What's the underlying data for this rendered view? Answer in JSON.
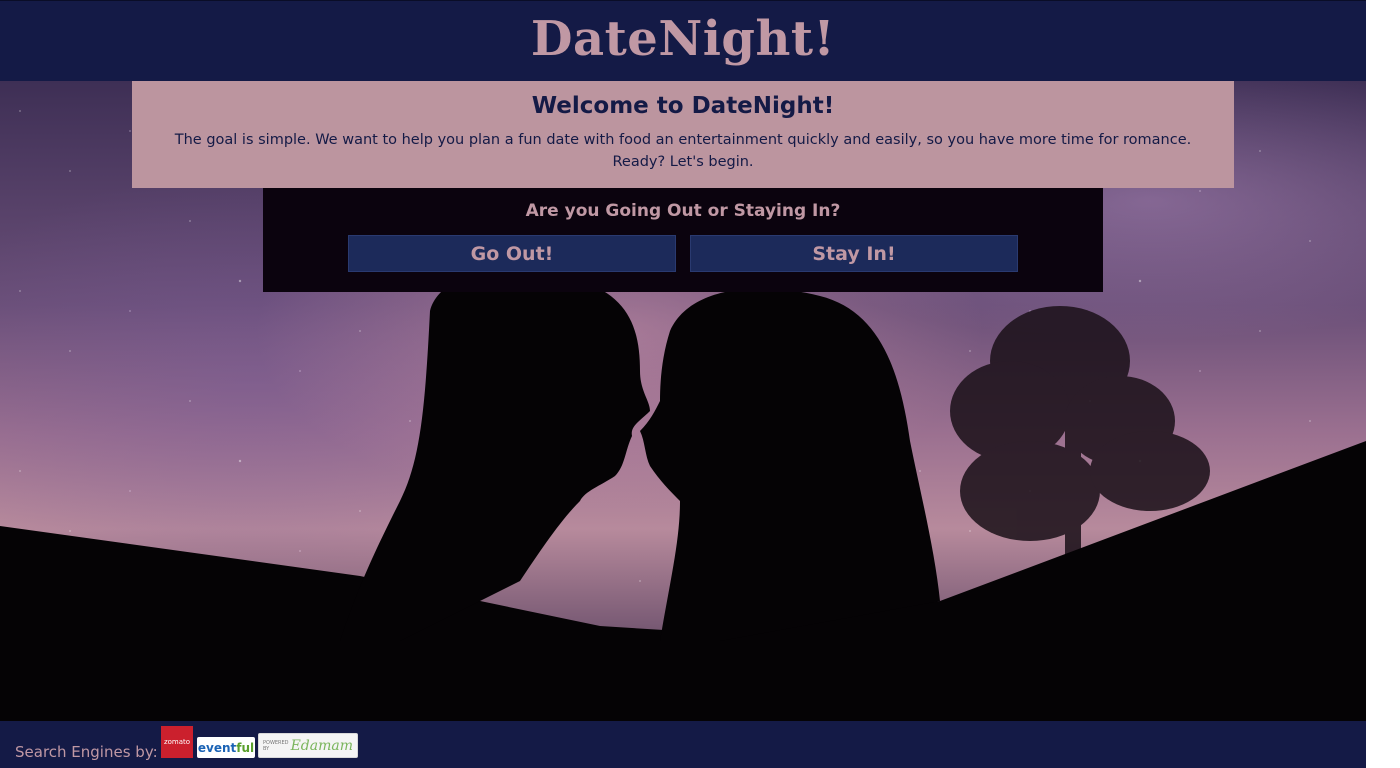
{
  "header": {
    "title": "DateNight!"
  },
  "welcome": {
    "heading": "Welcome to DateNight!",
    "line1": "The goal is simple. We want to help you plan a fun date with food an entertainment quickly and easily, so you have more time for romance.",
    "line2": "Ready? Let's begin."
  },
  "choice": {
    "question": "Are you Going Out or Staying In?",
    "go_out_label": "Go Out!",
    "stay_in_label": "Stay In!"
  },
  "footer": {
    "label": "Search Engines by:",
    "logos": [
      {
        "name": "zomato",
        "text": "zomato"
      },
      {
        "name": "eventful",
        "text_a": "event",
        "text_b": "ful"
      },
      {
        "name": "edamam",
        "prefix": "POWERED BY",
        "text": "Edamam"
      }
    ]
  },
  "colors": {
    "header_bg": "#141a46",
    "title_pink": "#c098a4",
    "welcome_bg": "#bc959f",
    "choice_bg": "#0b030e",
    "button_bg": "#1c2a5a"
  }
}
